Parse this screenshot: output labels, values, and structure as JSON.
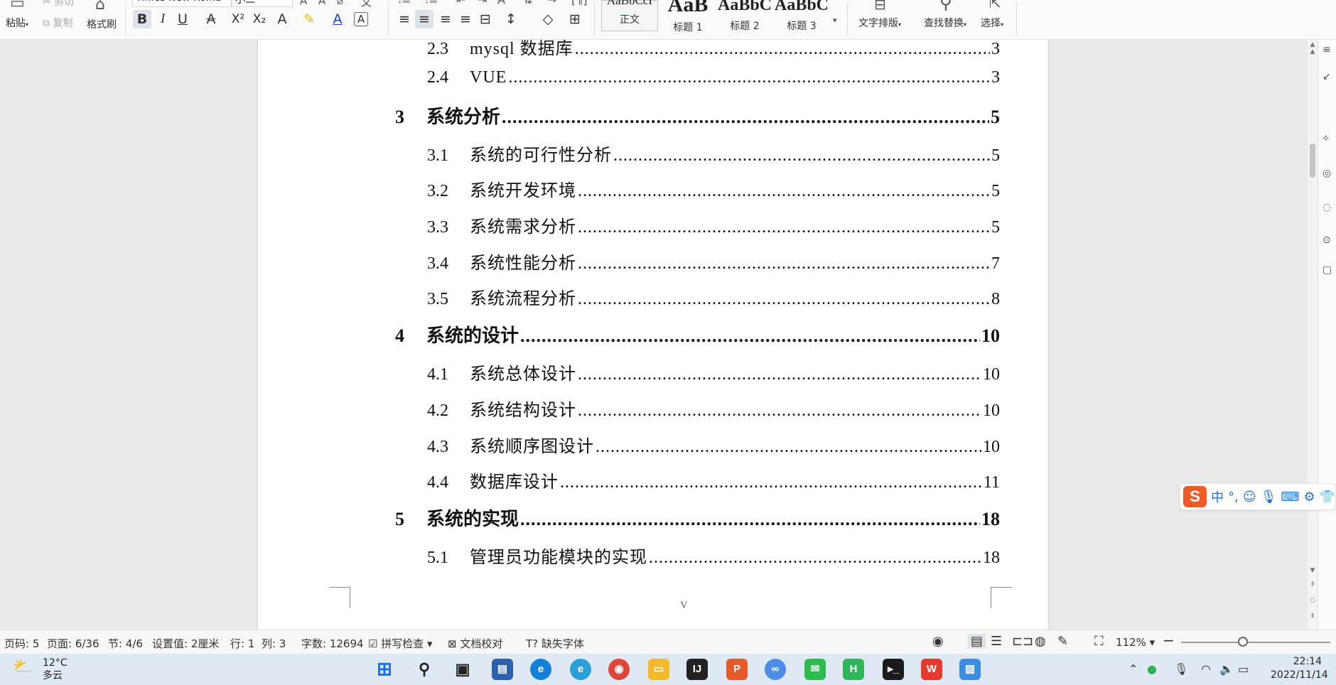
{
  "ribbon": {
    "clipboard": {
      "paste": "粘贴",
      "cut": "剪切",
      "copy": "复制",
      "format_painter": "格式刷"
    },
    "font": {
      "name": "Times New Roma",
      "size": "小二"
    },
    "styles": [
      {
        "sample": "AaBbCcI",
        "name": "正文"
      },
      {
        "sample": "AaB",
        "name": "标题 1"
      },
      {
        "sample": "AaBbC",
        "name": "标题 2"
      },
      {
        "sample": "AaBbC",
        "name": "标题 3"
      }
    ],
    "text_layout": "文字排版",
    "find_replace": "查找替换",
    "select": "选择"
  },
  "toc": [
    {
      "num": "2.3",
      "title": "mysql 数据库",
      "page": "3",
      "level": 2
    },
    {
      "num": "2.4",
      "title": "VUE",
      "page": "3",
      "level": 2
    },
    {
      "num": "3",
      "title": "系统分析",
      "page": "5",
      "level": 1
    },
    {
      "num": "3.1",
      "title": "系统的可行性分析",
      "page": "5",
      "level": 2
    },
    {
      "num": "3.2",
      "title": "系统开发环境",
      "page": "5",
      "level": 2
    },
    {
      "num": "3.3",
      "title": "系统需求分析",
      "page": "5",
      "level": 2
    },
    {
      "num": "3.4",
      "title": "系统性能分析",
      "page": "7",
      "level": 2
    },
    {
      "num": "3.5",
      "title": "系统流程分析",
      "page": "8",
      "level": 2
    },
    {
      "num": "4",
      "title": "系统的设计",
      "page": "10",
      "level": 1
    },
    {
      "num": "4.1",
      "title": "系统总体设计",
      "page": "10",
      "level": 2
    },
    {
      "num": "4.2",
      "title": "系统结构设计",
      "page": "10",
      "level": 2
    },
    {
      "num": "4.3",
      "title": "系统顺序图设计",
      "page": "10",
      "level": 2
    },
    {
      "num": "4.4",
      "title": "数据库设计",
      "page": "11",
      "level": 2
    },
    {
      "num": "5",
      "title": "系统的实现",
      "page": "18",
      "level": 1
    },
    {
      "num": "5.1",
      "title": "管理员功能模块的实现",
      "page": "18",
      "level": 2
    }
  ],
  "page_footer": "V",
  "status": {
    "page_code": "页码: 5",
    "page": "页面: 6/36",
    "section": "节: 4/6",
    "setting": "设置值: 2厘米",
    "row": "行: 1",
    "col": "列: 3",
    "word_count": "字数: 12694",
    "spell_check": "拼写检查",
    "doc_proof": "文档校对",
    "missing_font": "缺失字体",
    "zoom": "112%"
  },
  "ime": {
    "mode": "中"
  },
  "taskbar": {
    "weather_temp": "12°C",
    "weather_desc": "多云",
    "time": "22:14",
    "date": "2022/11/14"
  }
}
